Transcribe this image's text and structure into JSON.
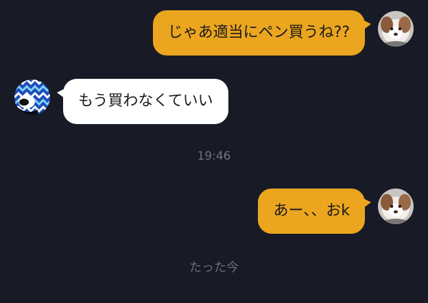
{
  "messages": [
    {
      "sender": "self",
      "text": "じゃあ適当にペン買うね??",
      "avatar": "dog-avatar"
    },
    {
      "sender": "other",
      "text": "もう買わなくていい",
      "avatar": "blue-pattern-avatar"
    },
    {
      "sender": "self",
      "text": "あー、、おk",
      "avatar": "dog-avatar"
    }
  ],
  "timestamp": "19:46",
  "read_status": "たった今",
  "colors": {
    "background": "#181a26",
    "outgoing_bubble": "#eba51e",
    "incoming_bubble": "#ffffff",
    "meta_text": "#6f7280"
  }
}
